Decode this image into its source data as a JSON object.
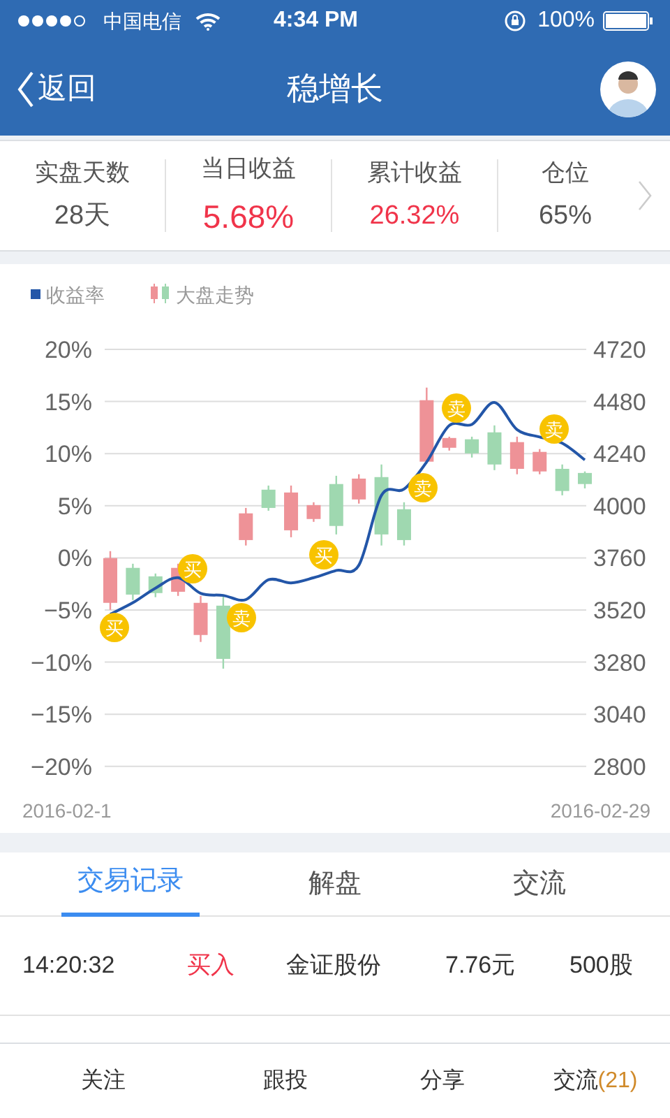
{
  "status_bar": {
    "carrier": "中国电信",
    "time": "4:34 PM",
    "battery": "100%"
  },
  "nav": {
    "back": "返回",
    "title": "稳增长"
  },
  "stats": [
    {
      "label": "实盘天数",
      "value": "28天",
      "color": "#555555"
    },
    {
      "label": "当日收益",
      "value": "5.68%",
      "color": "#f0344a"
    },
    {
      "label": "累计收益",
      "value": "26.32%",
      "color": "#f0344a"
    },
    {
      "label": "仓位",
      "value": "65%",
      "color": "#555555"
    }
  ],
  "chart": {
    "legend": [
      {
        "label": "大盘走势",
        "kind": "candle"
      }
    ],
    "x_labels": [
      "2016-02-1",
      "2016-02-29"
    ],
    "chart_data": {
      "type": "candlestick",
      "grid": true,
      "ylim": [
        2800,
        4720
      ],
      "yticks": [
        4720,
        4480,
        4240,
        4000,
        3760,
        3520,
        3280,
        3040,
        2800
      ],
      "y2lim": [
        -20,
        20
      ],
      "y2ticks": [
        {
          "value": 20,
          "label": "20%"
        },
        {
          "value": 15,
          "label": "15%"
        },
        {
          "value": 10,
          "label": "10%"
        },
        {
          "value": 5,
          "label": "5%"
        },
        {
          "value": 0,
          "label": "0%"
        },
        {
          "value": -5,
          "label": "−5%"
        },
        {
          "value": -10,
          "label": "−10%"
        },
        {
          "value": -15,
          "label": "−15%"
        },
        {
          "value": -20,
          "label": "−20%"
        }
      ],
      "series": [
        {
          "name": "收益率",
          "type": "line",
          "axis": "y2",
          "color": "#2356a8",
          "values": [
            -5.4,
            -4.3,
            -2.9,
            -1.9,
            -3.4,
            -3.6,
            -4.0,
            -2.1,
            -2.4,
            -1.9,
            -1.2,
            -0.7,
            6.0,
            6.6,
            9.2,
            12.7,
            12.8,
            14.9,
            12.3,
            11.6,
            11.0,
            9.4
          ]
        }
      ],
      "ohlc": [
        [
          3553,
          3791,
          3521,
          3759
        ],
        [
          3714,
          3733,
          3566,
          3591
        ],
        [
          3675,
          3688,
          3579,
          3598
        ],
        [
          3604,
          3733,
          3585,
          3714
        ],
        [
          3405,
          3585,
          3373,
          3553
        ],
        [
          3540,
          3585,
          3250,
          3295
        ],
        [
          3842,
          3990,
          3817,
          3965
        ],
        [
          4074,
          4093,
          3977,
          3990
        ],
        [
          3887,
          4093,
          3855,
          4061
        ],
        [
          3939,
          4016,
          3926,
          4003
        ],
        [
          4100,
          4138,
          3868,
          3907
        ],
        [
          4029,
          4145,
          4010,
          4125
        ],
        [
          4132,
          4190,
          3817,
          3868
        ],
        [
          3984,
          4016,
          3817,
          3842
        ],
        [
          4203,
          4544,
          4203,
          4486
        ],
        [
          4267,
          4318,
          4254,
          4312
        ],
        [
          4306,
          4318,
          4222,
          4241
        ],
        [
          4338,
          4370,
          4164,
          4190
        ],
        [
          4170,
          4318,
          4145,
          4293
        ],
        [
          4158,
          4261,
          4145,
          4248
        ],
        [
          4170,
          4190,
          4048,
          4068
        ],
        [
          4151,
          4158,
          4080,
          4100
        ]
      ]
    },
    "markers": [
      {
        "label": "买"
      },
      {
        "label": "买"
      },
      {
        "label": "卖"
      },
      {
        "label": "买"
      },
      {
        "label": "卖"
      },
      {
        "label": "卖"
      },
      {
        "label": "卖"
      }
    ]
  },
  "tabs": [
    {
      "label": "交易记录",
      "selected": true
    },
    {
      "label": "解盘",
      "selected": false
    },
    {
      "label": "交流",
      "selected": false
    }
  ],
  "trades": [
    {
      "time": "14:20:32",
      "action": "买入",
      "stock": "金证股份",
      "price": "7.76元",
      "quantity": "500股"
    }
  ],
  "bottom_bar": [
    {
      "label": "关注"
    },
    {
      "label": "跟投"
    },
    {
      "label": "分享"
    },
    {
      "label": "交流",
      "count": "(21)"
    }
  ]
}
